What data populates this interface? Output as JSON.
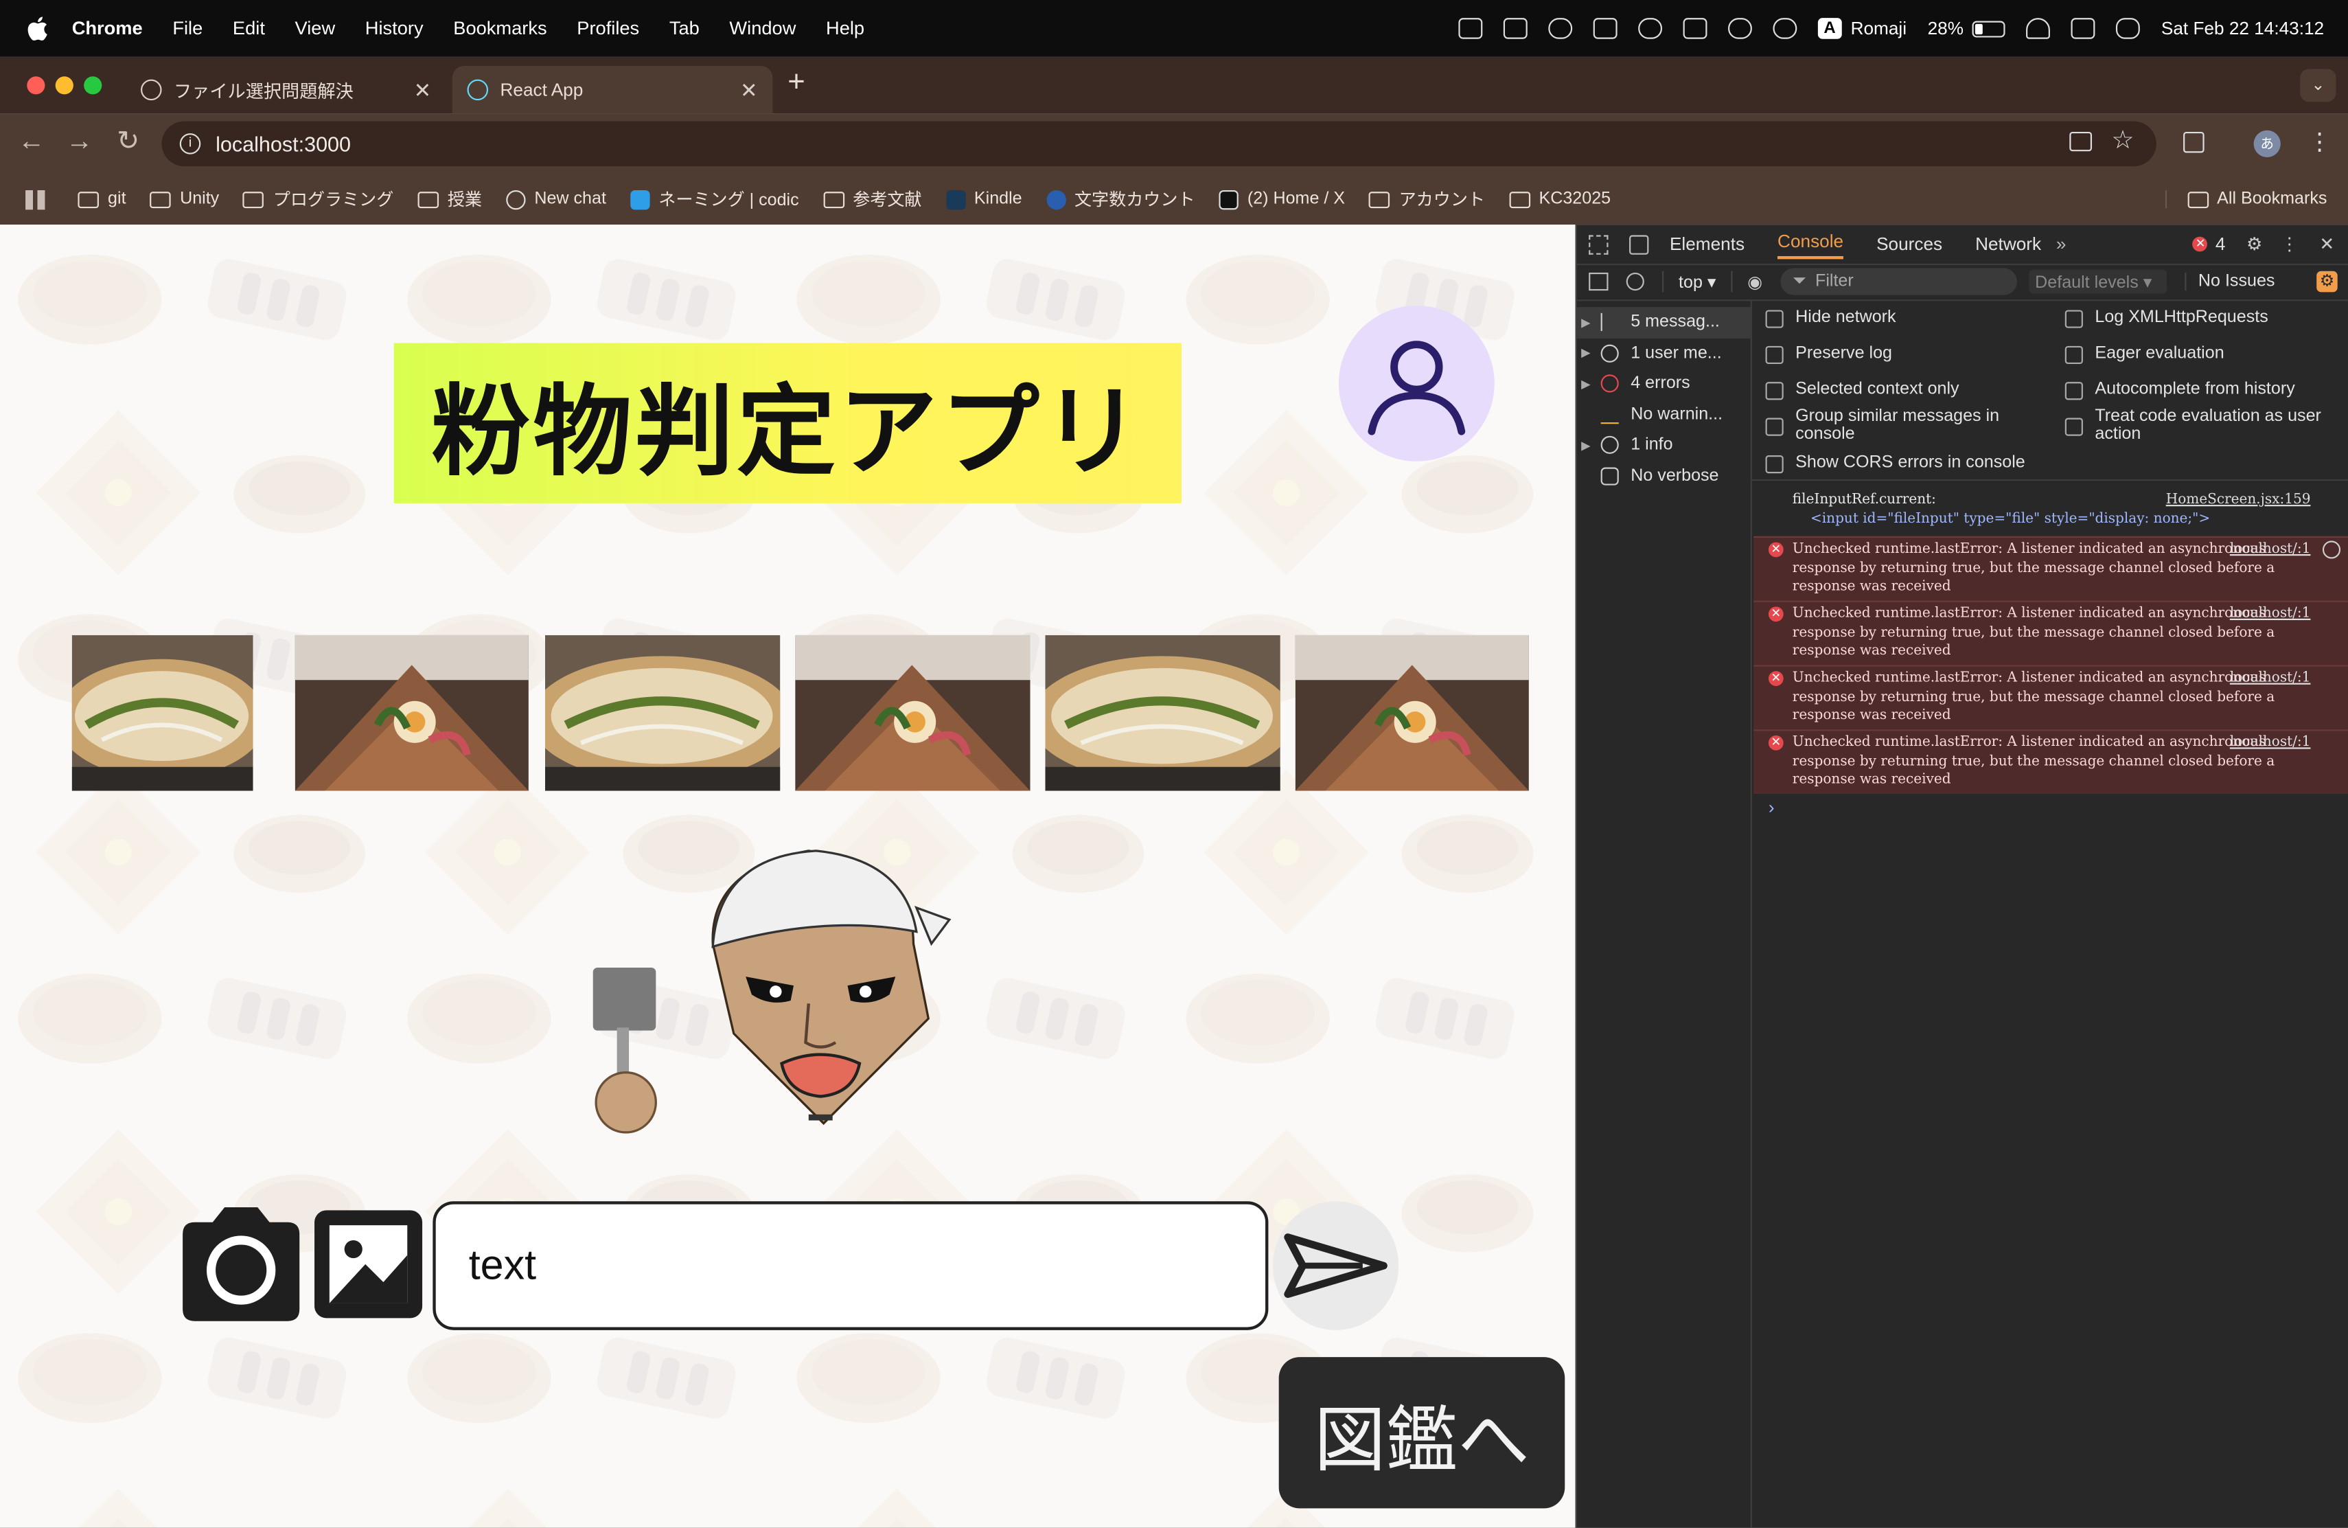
{
  "menubar": {
    "app_name": "Chrome",
    "items": [
      "File",
      "Edit",
      "View",
      "History",
      "Bookmarks",
      "Profiles",
      "Tab",
      "Window",
      "Help"
    ],
    "input_mode": "Romaji",
    "battery": "28%",
    "datetime": "Sat Feb 22  14:43:12"
  },
  "tabs": [
    {
      "title": "ファイル選択問題解決",
      "active": false
    },
    {
      "title": "React App",
      "active": true
    }
  ],
  "address_bar": {
    "url": "localhost:3000"
  },
  "bookmarks": [
    "git",
    "Unity",
    "プログラミング",
    "授業",
    "New chat",
    "ネーミング | codic",
    "参考文献",
    "Kindle",
    "文字数カウント",
    "(2) Home / X",
    "アカウント",
    "KC32025"
  ],
  "all_bookmarks": "All Bookmarks",
  "page": {
    "title": "粉物判定アプリ",
    "text_input_value": "text",
    "zukan_button": "図鑑へ",
    "thumbnails": [
      "okonomiyaki",
      "galette",
      "okonomiyaki",
      "galette",
      "okonomiyaki",
      "galette"
    ]
  },
  "devtools": {
    "tabs": [
      "Elements",
      "Console",
      "Sources",
      "Network"
    ],
    "error_count": "4",
    "context": "top",
    "filter_placeholder": "Filter",
    "levels": "Default levels",
    "issues": "No Issues",
    "sidebar": [
      {
        "label": "5 messag...",
        "icon": "list-icon"
      },
      {
        "label": "1 user me...",
        "icon": "user-icon"
      },
      {
        "label": "4 errors",
        "icon": "error-icon"
      },
      {
        "label": "No warnin...",
        "icon": "warning-icon"
      },
      {
        "label": "1 info",
        "icon": "info-icon"
      },
      {
        "label": "No verbose",
        "icon": "bug-icon"
      }
    ],
    "settings": {
      "left": [
        "Hide network",
        "Preserve log",
        "Selected context only",
        "Group similar messages in console",
        "Show CORS errors in console"
      ],
      "right": [
        "Log XMLHttpRequests",
        "Eager evaluation",
        "Autocomplete from history",
        "Treat code evaluation as user action"
      ]
    },
    "log_first": {
      "text": "fileInputRef.current:",
      "source": "HomeScreen.jsx:159",
      "html_tag": "<input id=\"fileInput\" type=\"file\" style=\"display: none;\">"
    },
    "errors": [
      {
        "text": "Unchecked runtime.lastError: A listener indicated an asynchronous response by returning true, but the message channel closed before a response was received",
        "source": "localhost/:1"
      },
      {
        "text": "Unchecked runtime.lastError: A listener indicated an asynchronous response by returning true, but the message channel closed before a response was received",
        "source": "localhost/:1"
      },
      {
        "text": "Unchecked runtime.lastError: A listener indicated an asynchronous response by returning true, but the message channel closed before a response was received",
        "source": "localhost/:1"
      },
      {
        "text": "Unchecked runtime.lastError: A listener indicated an asynchronous response by returning true, but the message channel closed before a response was received",
        "source": "localhost/:1"
      }
    ],
    "prompt": "›"
  },
  "colors": {
    "menubar": "#0d0d0d",
    "chrome_frame": "#4e3b32",
    "title_bg_start": "#d8ff4f",
    "title_bg_end": "#fff35e",
    "avatar_bg": "#e7dcfb",
    "avatar_fg": "#2b1f6b",
    "console_tab": "#f29d4a",
    "error_bg": "#4e2a2a"
  }
}
